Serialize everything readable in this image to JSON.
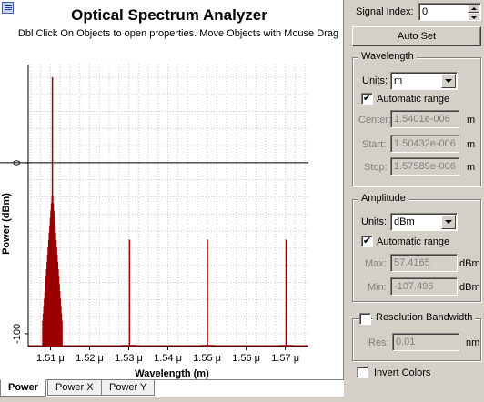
{
  "chart": {
    "title": "Optical Spectrum Analyzer",
    "subtitle": "Dbl Click On Objects to open properties.  Move Objects with Mouse Drag",
    "xlabel": "Wavelength (m)",
    "ylabel": "Power (dBm)"
  },
  "tabs": [
    {
      "label": "Power",
      "active": true
    },
    {
      "label": "Power X",
      "active": false
    },
    {
      "label": "Power Y",
      "active": false
    }
  ],
  "panel": {
    "signal_index_label": "Signal Index:",
    "signal_index_value": "0",
    "auto_set_label": "Auto Set",
    "wavelength": {
      "title": "Wavelength",
      "units_label": "Units:",
      "units_value": "m",
      "auto_range_label": "Automatic range",
      "auto_range_checked": "✔",
      "center_label": "Center:",
      "center_value": "1.5401e-006",
      "center_unit": "m",
      "start_label": "Start:",
      "start_value": "1.50432e-006",
      "start_unit": "m",
      "stop_label": "Stop:",
      "stop_value": "1.57589e-006",
      "stop_unit": "m"
    },
    "amplitude": {
      "title": "Amplitude",
      "units_label": "Units:",
      "units_value": "dBm",
      "auto_range_label": "Automatic range",
      "auto_range_checked": "✔",
      "max_label": "Max:",
      "max_value": "57.4165",
      "max_unit": "dBm",
      "min_label": "Min:",
      "min_value": "-107.496",
      "min_unit": "dBm"
    },
    "resolution": {
      "title": "Resolution Bandwidth",
      "checked": "",
      "res_label": "Res:",
      "res_value": "0.01",
      "res_unit": "nm"
    },
    "invert_colors_label": "Invert Colors",
    "invert_colors_checked": ""
  },
  "chart_data": {
    "type": "line",
    "title": "Optical Spectrum Analyzer",
    "xlabel": "Wavelength (m)",
    "ylabel": "Power (dBm)",
    "xlim": [
      1.50432e-06,
      1.57589e-06
    ],
    "ylim": [
      -107.496,
      57.4165
    ],
    "x_ticks": [
      1.51e-06,
      1.52e-06,
      1.53e-06,
      1.54e-06,
      1.55e-06,
      1.56e-06,
      1.57e-06
    ],
    "x_tick_labels": [
      "1.51 μ",
      "1.52 μ",
      "1.53 μ",
      "1.54 μ",
      "1.55 μ",
      "1.56 μ",
      "1.57 μ"
    ],
    "y_ticks": [
      0,
      -100
    ],
    "y_tick_labels": [
      "0",
      "-100"
    ],
    "grid": true,
    "color": "#990000",
    "spikes": [
      {
        "x": 1.5105e-06,
        "y": 50
      },
      {
        "x": 1.5302e-06,
        "y": -45
      },
      {
        "x": 1.5501e-06,
        "y": -45
      },
      {
        "x": 1.5702e-06,
        "y": -45
      }
    ],
    "sidebands": {
      "center": 1.5105e-06,
      "half_width": 2.5e-09,
      "peak": -15,
      "floor": -107.496
    },
    "baseline": -107.496
  }
}
